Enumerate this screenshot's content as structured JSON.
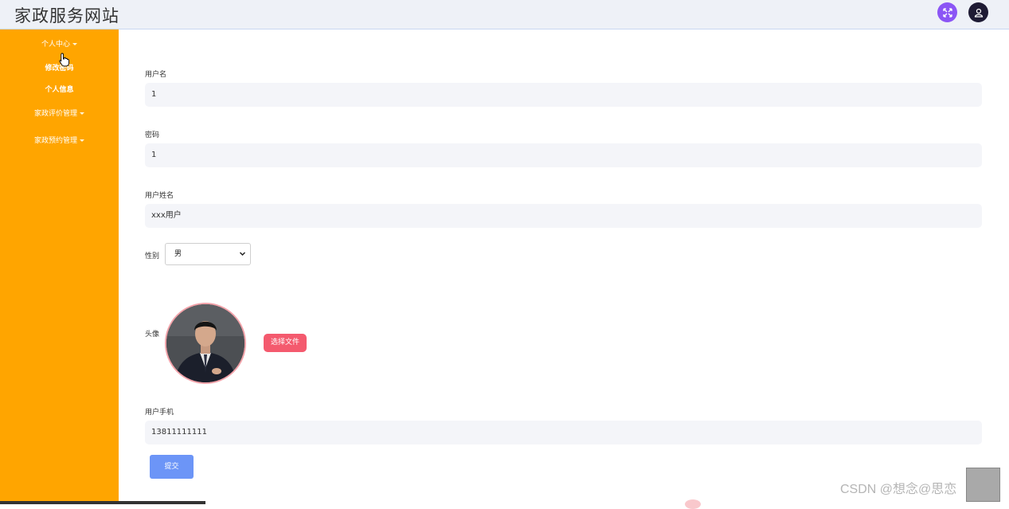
{
  "header": {
    "title": "家政服务网站",
    "action_button_icon": "expand-icon",
    "user_button_icon": "user-icon",
    "accent_purple": "#8b55f5",
    "dark": "#1e1b34"
  },
  "sidebar": {
    "background": "#ffa500",
    "items": [
      {
        "label": "个人中心",
        "has_caret": true
      },
      {
        "label": "修改密码",
        "has_caret": false
      },
      {
        "label": "个人信息",
        "has_caret": false
      },
      {
        "label": "家政评价管理",
        "has_caret": true
      },
      {
        "label": "家政预约管理",
        "has_caret": true
      }
    ]
  },
  "form": {
    "username_label": "用户名",
    "username_value": "1",
    "password_label": "密码",
    "password_value": "1",
    "realname_label": "用户姓名",
    "realname_value": "xxx用户",
    "gender_label": "性别",
    "gender_value": "男",
    "avatar_label": "头像",
    "choose_file_label": "选择文件",
    "phone_label": "用户手机",
    "phone_value": "13811111111",
    "submit_label": "提交"
  },
  "watermark": "CSDN @想念@思恋"
}
